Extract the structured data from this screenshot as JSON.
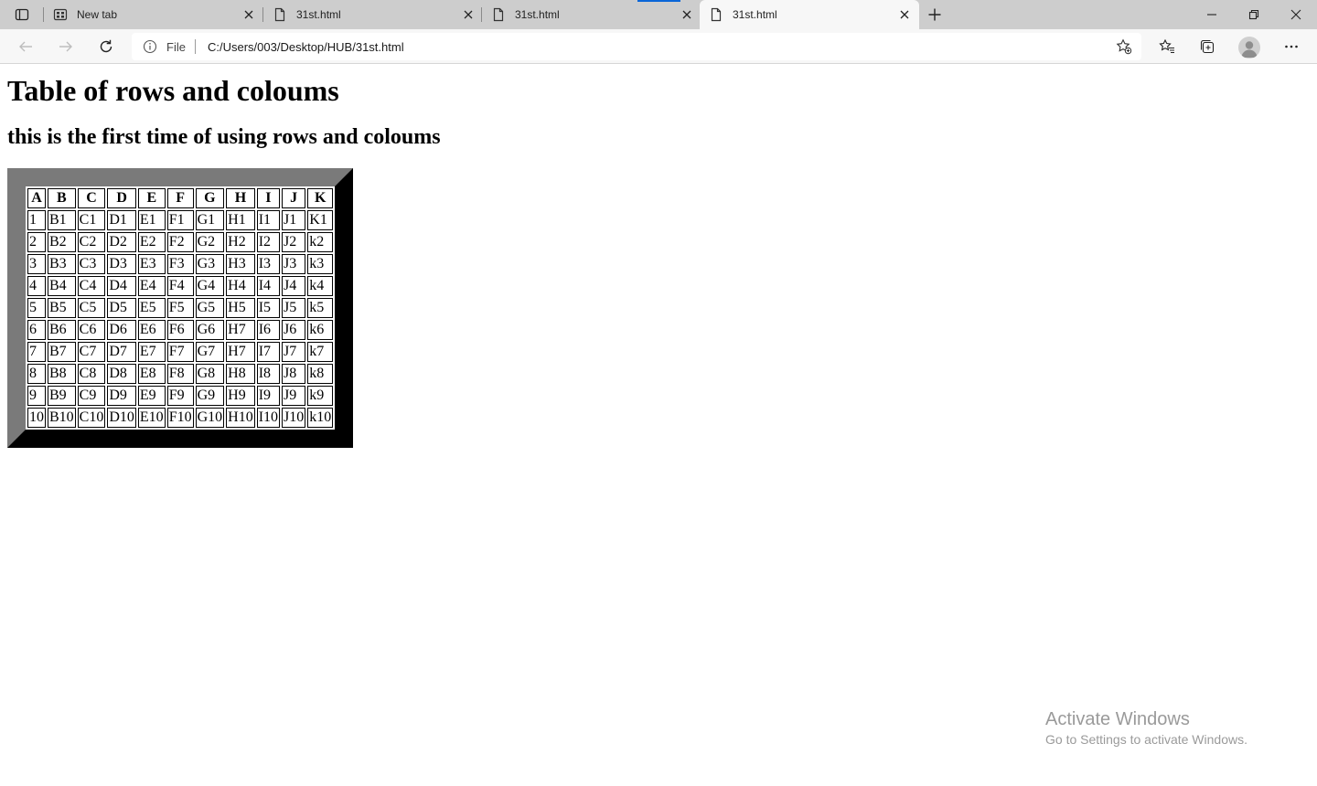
{
  "browser": {
    "tabs": [
      {
        "title": "New tab",
        "icon": "new-tab-page-icon",
        "active": false
      },
      {
        "title": "31st.html",
        "icon": "document-icon",
        "active": false
      },
      {
        "title": "31st.html",
        "icon": "document-icon",
        "active": false
      },
      {
        "title": "31st.html",
        "icon": "document-icon",
        "active": true
      }
    ],
    "address": {
      "scheme": "File",
      "url": "C:/Users/003/Desktop/HUB/31st.html"
    }
  },
  "page": {
    "heading": "Table of rows and coloums",
    "subheading": "this is the first time of using rows and coloums",
    "table": {
      "headers": [
        "A",
        "B",
        "C",
        "D",
        "E",
        "F",
        "G",
        "H",
        "I",
        "J",
        "K"
      ],
      "rows": [
        [
          "1",
          "B1",
          "C1",
          "D1",
          "E1",
          "F1",
          "G1",
          "H1",
          "I1",
          "J1",
          "K1"
        ],
        [
          "2",
          "B2",
          "C2",
          "D2",
          "E2",
          "F2",
          "G2",
          "H2",
          "I2",
          "J2",
          "k2"
        ],
        [
          "3",
          "B3",
          "C3",
          "D3",
          "E3",
          "F3",
          "G3",
          "H3",
          "I3",
          "J3",
          "k3"
        ],
        [
          "4",
          "B4",
          "C4",
          "D4",
          "E4",
          "F4",
          "G4",
          "H4",
          "I4",
          "J4",
          "k4"
        ],
        [
          "5",
          "B5",
          "C5",
          "D5",
          "E5",
          "F5",
          "G5",
          "H5",
          "I5",
          "J5",
          "k5"
        ],
        [
          "6",
          "B6",
          "C6",
          "D6",
          "E6",
          "F6",
          "G6",
          "H7",
          "I6",
          "J6",
          "k6"
        ],
        [
          "7",
          "B7",
          "C7",
          "D7",
          "E7",
          "F7",
          "G7",
          "H7",
          "I7",
          "J7",
          "k7"
        ],
        [
          "8",
          "B8",
          "C8",
          "D8",
          "E8",
          "F8",
          "G8",
          "H8",
          "I8",
          "J8",
          "k8"
        ],
        [
          "9",
          "B9",
          "C9",
          "D9",
          "E9",
          "F9",
          "G9",
          "H9",
          "I9",
          "J9",
          "k9"
        ],
        [
          "10",
          "B10",
          "C10",
          "D10",
          "E10",
          "F10",
          "G10",
          "H10",
          "I10",
          "J10",
          "k10"
        ]
      ]
    }
  },
  "watermark": {
    "title": "Activate Windows",
    "subtitle": "Go to Settings to activate Windows."
  }
}
